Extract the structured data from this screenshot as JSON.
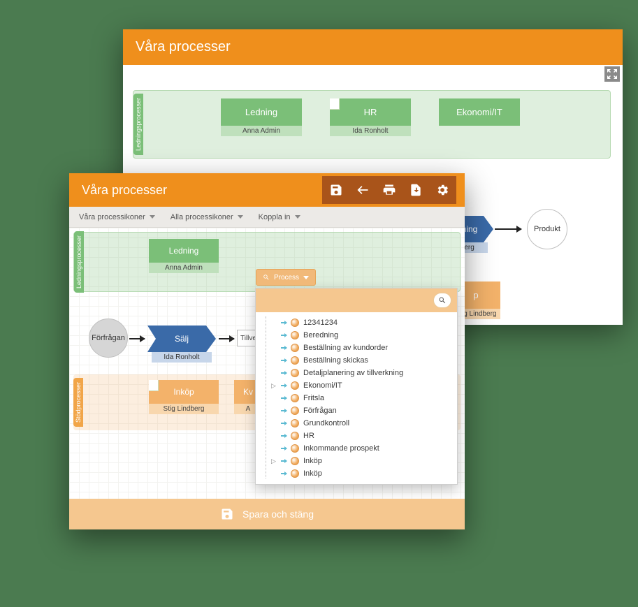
{
  "back": {
    "title": "Våra processer",
    "lanes": {
      "ledning": "Ledningsprocesser"
    },
    "boxes": {
      "ledning": {
        "label": "Ledning",
        "owner": "Anna Admin"
      },
      "hr": {
        "label": "HR",
        "owner": "Ida Ronholt"
      },
      "ekonomi": {
        "label": "Ekonomi/IT",
        "owner": ""
      },
      "tillverkning": {
        "label": "rkning",
        "owner": "dberg"
      },
      "produkt": {
        "label": "Produkt"
      },
      "stod1": {
        "label": "p",
        "owner": "Stig Lindberg"
      }
    }
  },
  "front": {
    "title": "Våra processer",
    "filters": {
      "f1": "Våra processikoner",
      "f2": "Alla processikoner",
      "f3": "Koppla in"
    },
    "lanes": {
      "ledning": "Ledningsprocesser",
      "stod": "Stödprocesser"
    },
    "boxes": {
      "ledning": {
        "label": "Ledning",
        "owner": "Anna Admin"
      },
      "forfragan": {
        "label": "Förfrågan"
      },
      "salj": {
        "label": "Sälj",
        "owner": "Ida Ronholt"
      },
      "tillv": {
        "label": "Tillve"
      },
      "inkop": {
        "label": "Inköp",
        "owner": "Stig Lindberg"
      },
      "kvalitet": {
        "label": "Kv",
        "owner": "A"
      }
    },
    "save": "Spara och stäng"
  },
  "popup": {
    "btn": "Process",
    "items": [
      {
        "exp": "",
        "label": "12341234"
      },
      {
        "exp": "",
        "label": "Beredning"
      },
      {
        "exp": "",
        "label": "Beställning av kundorder"
      },
      {
        "exp": "",
        "label": "Beställning skickas"
      },
      {
        "exp": "",
        "label": "Detaljplanering av tillverkning"
      },
      {
        "exp": "▷",
        "label": "Ekonomi/IT"
      },
      {
        "exp": "",
        "label": "Fritsla"
      },
      {
        "exp": "",
        "label": "Förfrågan"
      },
      {
        "exp": "",
        "label": "Grundkontroll"
      },
      {
        "exp": "",
        "label": "HR"
      },
      {
        "exp": "",
        "label": "Inkommande prospekt"
      },
      {
        "exp": "▷",
        "label": "Inköp"
      },
      {
        "exp": "",
        "label": "Inköp"
      }
    ]
  }
}
